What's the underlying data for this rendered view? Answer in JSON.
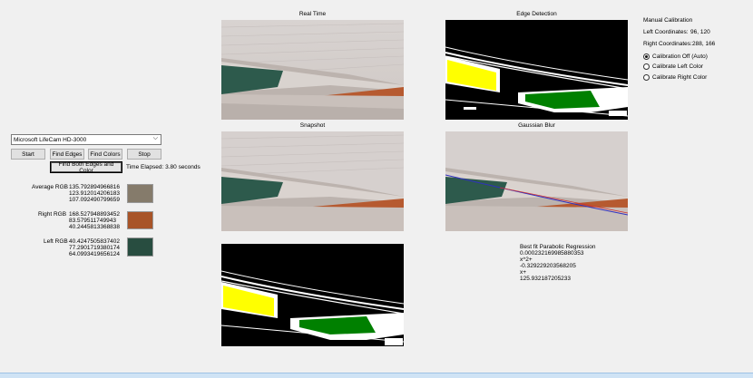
{
  "camera_select": {
    "value": "Microsoft LifeCam HD-3000"
  },
  "buttons": {
    "start": "Start",
    "find_edges": "Find Edges",
    "find_colors": "Find Colors",
    "stop": "Stop",
    "find_both": "Find Both Edges and Color"
  },
  "time_elapsed": "Time Elapsed: 3.80 seconds",
  "rgb": {
    "average": {
      "label": "Average RGB",
      "values": [
        "135.792894966816",
        "123.912014206183",
        "107.092490799659"
      ],
      "color": "#857b6b"
    },
    "right": {
      "label": "Right RGB",
      "values": [
        "168.527948893452",
        "83.579511749943",
        "40.2445813368838"
      ],
      "color": "#a85428"
    },
    "left": {
      "label": "Left RGB",
      "values": [
        "40.4247505837402",
        "77.2901719380174",
        "64.0993419656124"
      ],
      "color": "#284d40"
    }
  },
  "panels": {
    "real_time": "Real Time",
    "edge_detection": "Edge Detection",
    "snapshot": "Snapshot",
    "gaussian_blur": "Gaussian Blur"
  },
  "regression": {
    "title": "Best fit Parabolic Regression",
    "lines": [
      "0.000232169985880353",
      "x^2+",
      "-0.329229203568205",
      "x+",
      "125.932187205233"
    ]
  },
  "calibration": {
    "title": "Manual Calibration",
    "left_coords_label": "Left Coordinates:",
    "left_coords_value": "96, 120",
    "right_coords_label": "Right Coordinates:",
    "right_coords_value": "288, 166",
    "options": [
      "Calibration Off (Auto)",
      "Calibrate Left Color",
      "Calibrate Right Color"
    ],
    "selected_index": 0
  }
}
